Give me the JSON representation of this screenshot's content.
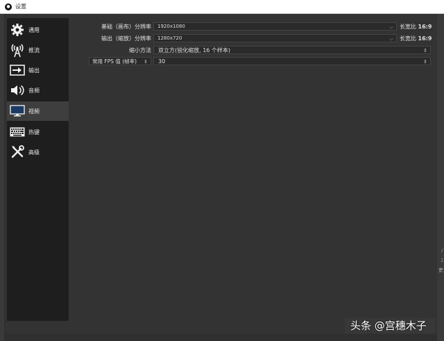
{
  "window": {
    "title": "设置"
  },
  "sidebar": {
    "items": [
      {
        "label": "通用",
        "icon": "gear-icon"
      },
      {
        "label": "推流",
        "icon": "antenna-icon"
      },
      {
        "label": "输出",
        "icon": "output-icon"
      },
      {
        "label": "音频",
        "icon": "speaker-icon"
      },
      {
        "label": "视频",
        "icon": "monitor-icon"
      },
      {
        "label": "热键",
        "icon": "keyboard-icon"
      },
      {
        "label": "高级",
        "icon": "tools-icon"
      }
    ],
    "active_index": 4
  },
  "video": {
    "base_resolution": {
      "label": "基础（画布）分辨率",
      "value": "1920x1080",
      "aspect_prefix": "长宽比",
      "aspect_value": "16:9"
    },
    "output_resolution": {
      "label": "输出（缩放）分辨率",
      "value": "1280x720",
      "aspect_prefix": "长宽比",
      "aspect_value": "16:9"
    },
    "downscale_filter": {
      "label": "缩小方法",
      "value": "双立方(锐化缩放, 16 个样本)"
    },
    "fps": {
      "label": "常用 FPS 值 (帧率)",
      "value": "30"
    }
  },
  "background": {
    "right_chars": [
      "ﾉ",
      "ｴ",
      "吏"
    ]
  },
  "watermark": {
    "text": "头条 @宫穗木子"
  }
}
